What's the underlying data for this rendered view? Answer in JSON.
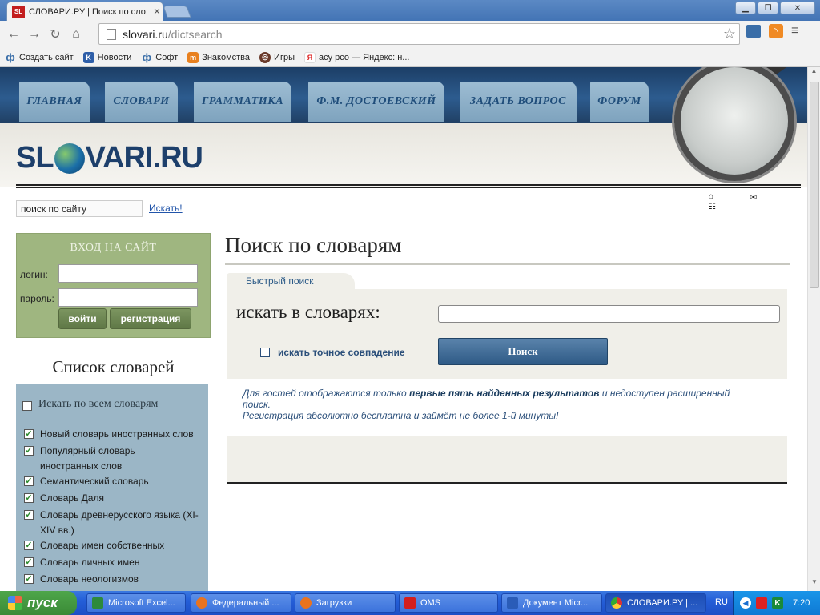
{
  "browser": {
    "tab_title": "СЛОВАРИ.РУ | Поиск по сло",
    "tab_favicon": "SL",
    "url_host": "slovari.ru",
    "url_path": "/dictsearch",
    "bookmarks": [
      {
        "label": "Создать сайт",
        "icon": "cyrillic-f-icon"
      },
      {
        "label": "Новости",
        "icon": "k-icon"
      },
      {
        "label": "Софт",
        "icon": "cyrillic-f-icon"
      },
      {
        "label": "Знакомства",
        "icon": "m-icon"
      },
      {
        "label": "Игры",
        "icon": "target-icon"
      },
      {
        "label": "асу рсо — Яндекс: н...",
        "icon": "yandex-icon"
      }
    ]
  },
  "site": {
    "nav": [
      "ГЛАВНАЯ",
      "СЛОВАРИ",
      "ГРАММАТИКА",
      "Ф.М. ДОСТОЕВСКИЙ",
      "ЗАДАТЬ ВОПРОС",
      "ФОРУМ"
    ],
    "logo_left": "SL",
    "logo_right": "VARI.RU",
    "search_value": "поиск по сайту",
    "search_button": "Искать!"
  },
  "login": {
    "title": "ВХОД НА САЙТ",
    "login_label": "логин:",
    "password_label": "пароль:",
    "enter_button": "войти",
    "register_button": "регистрация"
  },
  "dictionaries": {
    "title": "Список словарей",
    "all_label": "Искать по всем словарям",
    "items": [
      "Новый словарь иностранных слов",
      "Популярный словарь иностранных слов",
      "Семантический словарь",
      "Словарь Даля",
      "Словарь древнерусского языка (XI-XIV вв.)",
      "Словарь имен собственных",
      "Словарь личных имен",
      "Словарь неологизмов"
    ]
  },
  "main": {
    "title": "Поиск по словарям",
    "quick_tab": "Быстрый поиск",
    "search_label": "искать в словарях:",
    "exact_label": "искать точное совпадение",
    "search_button": "Поиск",
    "note_part1": "Для гостей отображаются только ",
    "note_bold": "первые пять найденных результатов",
    "note_part2": " и недоступен расширенный поиск.",
    "note_link": "Регистрация",
    "note_part3": " абсолютно бесплатна и займёт не более 1-й минуты!"
  },
  "taskbar": {
    "start": "пуск",
    "tasks": [
      {
        "label": "Microsoft Excel...",
        "icon": "excel-icon"
      },
      {
        "label": "Федеральный ...",
        "icon": "firefox-icon"
      },
      {
        "label": "Загрузки",
        "icon": "firefox-icon"
      },
      {
        "label": "OMS",
        "icon": "oms-icon"
      },
      {
        "label": "Документ Micr...",
        "icon": "word-icon"
      },
      {
        "label": "СЛОВАРИ.РУ | ...",
        "icon": "chrome-icon"
      }
    ],
    "language": "RU",
    "clock": "7:20"
  }
}
